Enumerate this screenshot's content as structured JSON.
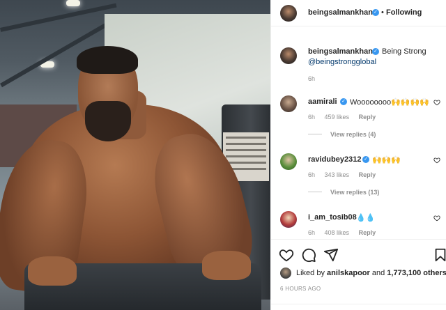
{
  "header": {
    "username": "beingsalmankhan",
    "separator": "•",
    "follow_label": "Following"
  },
  "caption": {
    "username": "beingsalmankhan",
    "text": "Being Strong",
    "mention": "@beingstrongglobal",
    "time": "6h"
  },
  "comments": [
    {
      "username": "aamirali",
      "verified": true,
      "text": "Woooooooo🙌🙌🙌🙌",
      "time": "6h",
      "likes": "459 likes",
      "reply_label": "Reply",
      "view_replies": "View replies (4)"
    },
    {
      "username": "ravidubey2312",
      "verified": true,
      "text": "🙌🙌🙌",
      "time": "6h",
      "likes": "343 likes",
      "reply_label": "Reply",
      "view_replies": "View replies (13)"
    },
    {
      "username": "i_am_tosib08",
      "verified": false,
      "text": "💧💧",
      "time": "6h",
      "likes": "408 likes",
      "reply_label": "Reply"
    }
  ],
  "likes": {
    "prefix": "Liked by",
    "liker": "anilskapoor",
    "joiner": "and",
    "others": "1,773,100 others"
  },
  "posted_ago": "6 HOURS AGO",
  "icons": {
    "verified": "verified-badge-icon",
    "heart": "heart-icon",
    "comment": "comment-icon",
    "share": "share-icon",
    "save": "bookmark-icon"
  },
  "colors": {
    "verified": "#3897f0",
    "link": "#00376b",
    "muted": "#8e8e8e",
    "text": "#262626"
  }
}
